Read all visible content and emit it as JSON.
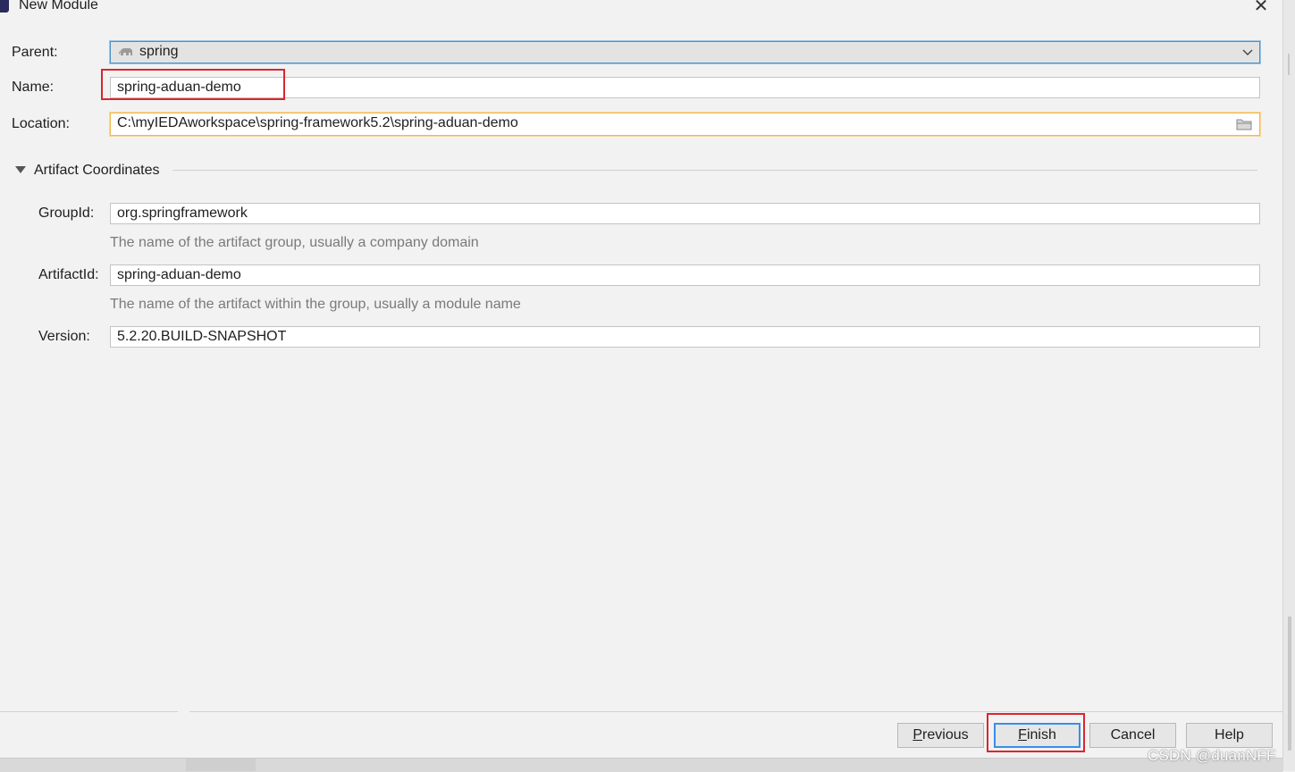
{
  "window": {
    "title": "New Module"
  },
  "form": {
    "parent_label": "Parent:",
    "parent_value": "spring",
    "name_label": "Name:",
    "name_value": "spring-aduan-demo",
    "location_label": "Location:",
    "location_value": "C:\\myIEDAworkspace\\spring-framework5.2\\spring-aduan-demo"
  },
  "artifact": {
    "section_title": "Artifact Coordinates",
    "groupid_label": "GroupId:",
    "groupid_value": "org.springframework",
    "groupid_hint": "The name of the artifact group, usually a company domain",
    "artifactid_label": "ArtifactId:",
    "artifactid_value": "spring-aduan-demo",
    "artifactid_hint": "The name of the artifact within the group, usually a module name",
    "version_label": "Version:",
    "version_value": "5.2.20.BUILD-SNAPSHOT"
  },
  "buttons": {
    "previous_mnemonic": "P",
    "previous_rest": "revious",
    "finish_mnemonic": "F",
    "finish_rest": "inish",
    "cancel": "Cancel",
    "help": "Help"
  },
  "watermark": "CSDN @duanNFF",
  "colors": {
    "highlight_box": "#d9262f",
    "focus_border": "#f0b84e",
    "default_button_border": "#3a8ee6"
  },
  "icons": [
    "app-icon",
    "close-icon",
    "elephant-icon",
    "chevron-down-icon",
    "folder-icon",
    "triangle-down-icon"
  ]
}
